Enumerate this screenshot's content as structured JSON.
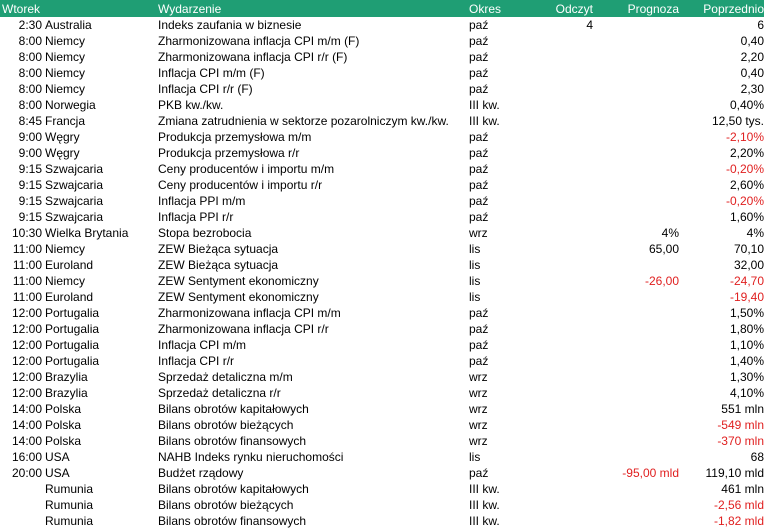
{
  "header": {
    "day": "Wtorek",
    "event": "Wydarzenie",
    "period": "Okres",
    "actual": "Odczyt",
    "forecast": "Prognoza",
    "previous": "Poprzednio"
  },
  "colors": {
    "header_bg": "#1f9e74",
    "negative": "#e02020"
  },
  "rows": [
    {
      "time": "2:30",
      "country": "Australia",
      "event": "Indeks zaufania w biznesie",
      "period": "paź",
      "actual": "4",
      "forecast": "",
      "previous": "6"
    },
    {
      "time": "8:00",
      "country": "Niemcy",
      "event": "Zharmonizowana inflacja CPI m/m (F)",
      "period": "paź",
      "actual": "",
      "forecast": "",
      "previous": "0,40"
    },
    {
      "time": "8:00",
      "country": "Niemcy",
      "event": "Zharmonizowana inflacja CPI r/r (F)",
      "period": "paź",
      "actual": "",
      "forecast": "",
      "previous": "2,20"
    },
    {
      "time": "8:00",
      "country": "Niemcy",
      "event": "Inflacja CPI m/m (F)",
      "period": "paź",
      "actual": "",
      "forecast": "",
      "previous": "0,40"
    },
    {
      "time": "8:00",
      "country": "Niemcy",
      "event": "Inflacja CPI r/r (F)",
      "period": "paź",
      "actual": "",
      "forecast": "",
      "previous": "2,30"
    },
    {
      "time": "8:00",
      "country": "Norwegia",
      "event": "PKB kw./kw.",
      "period": "III kw.",
      "actual": "",
      "forecast": "",
      "previous": "0,40%"
    },
    {
      "time": "8:45",
      "country": "Francja",
      "event": "Zmiana zatrudnienia w sektorze pozarolniczym kw./kw.",
      "period": "III kw.",
      "actual": "",
      "forecast": "",
      "previous": "12,50 tys."
    },
    {
      "time": "9:00",
      "country": "Węgry",
      "event": "Produkcja przemysłowa m/m",
      "period": "paź",
      "actual": "",
      "forecast": "",
      "previous": "-2,10%"
    },
    {
      "time": "9:00",
      "country": "Węgry",
      "event": "Produkcja przemysłowa r/r",
      "period": "paź",
      "actual": "",
      "forecast": "",
      "previous": "2,20%"
    },
    {
      "time": "9:15",
      "country": "Szwajcaria",
      "event": "Ceny producentów i importu m/m",
      "period": "paź",
      "actual": "",
      "forecast": "",
      "previous": "-0,20%"
    },
    {
      "time": "9:15",
      "country": "Szwajcaria",
      "event": "Ceny producentów i importu r/r",
      "period": "paź",
      "actual": "",
      "forecast": "",
      "previous": "2,60%"
    },
    {
      "time": "9:15",
      "country": "Szwajcaria",
      "event": "Inflacja PPI m/m",
      "period": "paź",
      "actual": "",
      "forecast": "",
      "previous": "-0,20%"
    },
    {
      "time": "9:15",
      "country": "Szwajcaria",
      "event": "Inflacja PPI r/r",
      "period": "paź",
      "actual": "",
      "forecast": "",
      "previous": "1,60%"
    },
    {
      "time": "10:30",
      "country": "Wielka Brytania",
      "event": "Stopa bezrobocia",
      "period": "wrz",
      "actual": "",
      "forecast": "4%",
      "previous": "4%"
    },
    {
      "time": "11:00",
      "country": "Niemcy",
      "event": "ZEW Bieżąca sytuacja",
      "period": "lis",
      "actual": "",
      "forecast": "65,00",
      "previous": "70,10"
    },
    {
      "time": "11:00",
      "country": "Euroland",
      "event": "ZEW Bieżąca sytuacja",
      "period": "lis",
      "actual": "",
      "forecast": "",
      "previous": "32,00"
    },
    {
      "time": "11:00",
      "country": "Niemcy",
      "event": "ZEW Sentyment ekonomiczny",
      "period": "lis",
      "actual": "",
      "forecast": "-26,00",
      "previous": "-24,70"
    },
    {
      "time": "11:00",
      "country": "Euroland",
      "event": "ZEW Sentyment ekonomiczny",
      "period": "lis",
      "actual": "",
      "forecast": "",
      "previous": "-19,40"
    },
    {
      "time": "12:00",
      "country": "Portugalia",
      "event": "Zharmonizowana inflacja CPI m/m",
      "period": "paź",
      "actual": "",
      "forecast": "",
      "previous": "1,50%"
    },
    {
      "time": "12:00",
      "country": "Portugalia",
      "event": "Zharmonizowana inflacja CPI r/r",
      "period": "paź",
      "actual": "",
      "forecast": "",
      "previous": "1,80%"
    },
    {
      "time": "12:00",
      "country": "Portugalia",
      "event": "Inflacja CPI m/m",
      "period": "paź",
      "actual": "",
      "forecast": "",
      "previous": "1,10%"
    },
    {
      "time": "12:00",
      "country": "Portugalia",
      "event": "Inflacja CPI r/r",
      "period": "paź",
      "actual": "",
      "forecast": "",
      "previous": "1,40%"
    },
    {
      "time": "12:00",
      "country": "Brazylia",
      "event": "Sprzedaż detaliczna m/m",
      "period": "wrz",
      "actual": "",
      "forecast": "",
      "previous": "1,30%"
    },
    {
      "time": "12:00",
      "country": "Brazylia",
      "event": "Sprzedaż detaliczna r/r",
      "period": "wrz",
      "actual": "",
      "forecast": "",
      "previous": "4,10%"
    },
    {
      "time": "14:00",
      "country": "Polska",
      "event": "Bilans obrotów kapitałowych",
      "period": "wrz",
      "actual": "",
      "forecast": "",
      "previous": "551 mln"
    },
    {
      "time": "14:00",
      "country": "Polska",
      "event": "Bilans obrotów bieżących",
      "period": "wrz",
      "actual": "",
      "forecast": "",
      "previous": "-549 mln"
    },
    {
      "time": "14:00",
      "country": "Polska",
      "event": "Bilans obrotów finansowych",
      "period": "wrz",
      "actual": "",
      "forecast": "",
      "previous": "-370 mln"
    },
    {
      "time": "16:00",
      "country": "USA",
      "event": "NAHB Indeks rynku nieruchomości",
      "period": "lis",
      "actual": "",
      "forecast": "",
      "previous": "68"
    },
    {
      "time": "20:00",
      "country": "USA",
      "event": "Budżet rządowy",
      "period": "paź",
      "actual": "",
      "forecast": "-95,00 mld",
      "previous": "119,10 mld"
    },
    {
      "time": "",
      "country": "Rumunia",
      "event": "Bilans obrotów kapitałowych",
      "period": "III kw.",
      "actual": "",
      "forecast": "",
      "previous": "461 mln"
    },
    {
      "time": "",
      "country": "Rumunia",
      "event": "Bilans obrotów bieżących",
      "period": "III kw.",
      "actual": "",
      "forecast": "",
      "previous": "-2,56 mld"
    },
    {
      "time": "",
      "country": "Rumunia",
      "event": "Bilans obrotów finansowych",
      "period": "III kw.",
      "actual": "",
      "forecast": "",
      "previous": "-1,82 mld"
    }
  ]
}
